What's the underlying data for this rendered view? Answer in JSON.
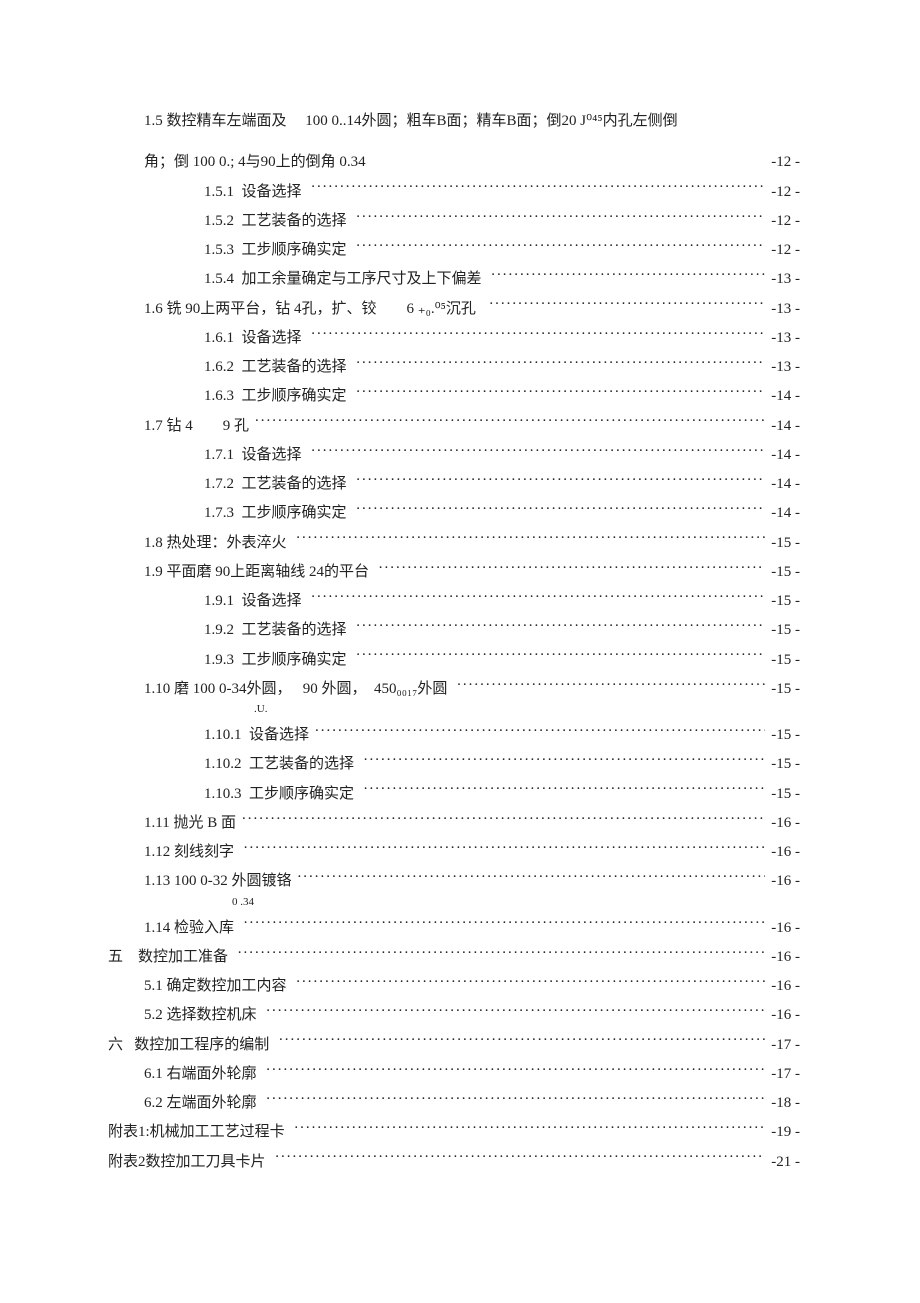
{
  "entries": [
    {
      "type": "plain2",
      "indent": "ind1",
      "line1": "1.5 数控精车左端面及　 100 0..14外圆；粗车B面；精车B面；倒20 J⁰⁴⁵内孔左侧倒",
      "line2_left": "角；倒 100 0.; 4与90上的倒角 0.34",
      "line2_page": "-12 -"
    },
    {
      "type": "dots",
      "indent": "ind2",
      "label": "1.5.1  设备选择 ",
      "page": "-12 -"
    },
    {
      "type": "dots",
      "indent": "ind2",
      "label": "1.5.2  工艺装备的选择 ",
      "page": "-12 -"
    },
    {
      "type": "dots",
      "indent": "ind2",
      "label": "1.5.3  工步顺序确实定 ",
      "page": "-12 -"
    },
    {
      "type": "dots",
      "indent": "ind2",
      "label": "1.5.4  加工余量确定与工序尺寸及上下偏差 ",
      "page": "-13 -"
    },
    {
      "type": "dots",
      "indent": "ind1",
      "label": "1.6 铣 90上两平台，钻 4孔，扩、铰　　6 ₊₀.⁰⁵沉孔  ",
      "page": "-13 -"
    },
    {
      "type": "dots",
      "indent": "ind2",
      "label": "1.6.1  设备选择 ",
      "page": "-13 -"
    },
    {
      "type": "dots",
      "indent": "ind2",
      "label": "1.6.2  工艺装备的选择 ",
      "page": "-13 -"
    },
    {
      "type": "dots",
      "indent": "ind2",
      "label": "1.6.3  工步顺序确实定 ",
      "page": "-14 -"
    },
    {
      "type": "dots",
      "indent": "ind1",
      "label": "1.7 钻 4　　9 孔",
      "page": "-14 -"
    },
    {
      "type": "dots",
      "indent": "ind2",
      "label": "1.7.1  设备选择 ",
      "page": "-14 -"
    },
    {
      "type": "dots",
      "indent": "ind2",
      "label": "1.7.2  工艺装备的选择 ",
      "page": "-14 -"
    },
    {
      "type": "dots",
      "indent": "ind2",
      "label": "1.7.3  工步顺序确实定 ",
      "page": "-14 -"
    },
    {
      "type": "dots",
      "indent": "ind1",
      "label": "1.8 热处理：外表淬火 ",
      "page": "-15 -"
    },
    {
      "type": "dots",
      "indent": "ind1",
      "label": "1.9 平面磨 90上距离轴线 24的平台 ",
      "page": "-15 -"
    },
    {
      "type": "dots",
      "indent": "ind2",
      "label": "1.9.1  设备选择 ",
      "page": "-15 -"
    },
    {
      "type": "dots",
      "indent": "ind2",
      "label": "1.9.2  工艺装备的选择 ",
      "page": "-15 -"
    },
    {
      "type": "dots",
      "indent": "ind2",
      "label": "1.9.3  工步顺序确实定 ",
      "page": "-15 -"
    },
    {
      "type": "dots_under",
      "indent": "ind1",
      "label": "1.10 磨 100 0-34外圆，　 90 外圆，　450₀₀₁₇外圆 ",
      "under": "　　　　　　　　　　.U.",
      "page": "-15 -"
    },
    {
      "type": "dots",
      "indent": "ind2",
      "label": "1.10.1  设备选择",
      "page": "-15 -"
    },
    {
      "type": "dots",
      "indent": "ind2",
      "label": "1.10.2  工艺装备的选择 ",
      "page": "-15 -"
    },
    {
      "type": "dots",
      "indent": "ind2",
      "label": "1.10.3  工步顺序确实定 ",
      "page": "-15 -"
    },
    {
      "type": "dots",
      "indent": "ind1",
      "label": "1.11 抛光 B 面",
      "page": "-16 -"
    },
    {
      "type": "dots",
      "indent": "ind1",
      "label": "1.12 刻线刻字 ",
      "page": "-16 -"
    },
    {
      "type": "dots_under",
      "indent": "ind1",
      "label": "1.13 100 0-32 外圆镀铬",
      "under": "　　　　　　　　0 .34",
      "page": "-16 -"
    },
    {
      "type": "dots",
      "indent": "ind1",
      "label": "1.14 检验入库 ",
      "page": "-16 -"
    },
    {
      "type": "dots",
      "indent": "ind0",
      "label": "五　数控加工准备 ",
      "page": "-16 -"
    },
    {
      "type": "dots",
      "indent": "ind1",
      "label": "5.1 确定数控加工内容 ",
      "page": "-16 -"
    },
    {
      "type": "dots",
      "indent": "ind1",
      "label": "5.2 选择数控机床 ",
      "page": "-16 -"
    },
    {
      "type": "dots",
      "indent": "ind0",
      "label": "六   数控加工程序的编制 ",
      "page": "-17 -"
    },
    {
      "type": "dots",
      "indent": "ind1",
      "label": "6.1 右端面外轮廓 ",
      "page": "-17 -"
    },
    {
      "type": "dots",
      "indent": "ind1",
      "label": "6.2 左端面外轮廓 ",
      "page": "-18 -"
    },
    {
      "type": "dots",
      "indent": "ind0",
      "label": "附表1:机械加工工艺过程卡 ",
      "page": "-19 -"
    },
    {
      "type": "dots",
      "indent": "ind0",
      "label": "附表2数控加工刀具卡片 ",
      "page": "-21 -"
    }
  ]
}
